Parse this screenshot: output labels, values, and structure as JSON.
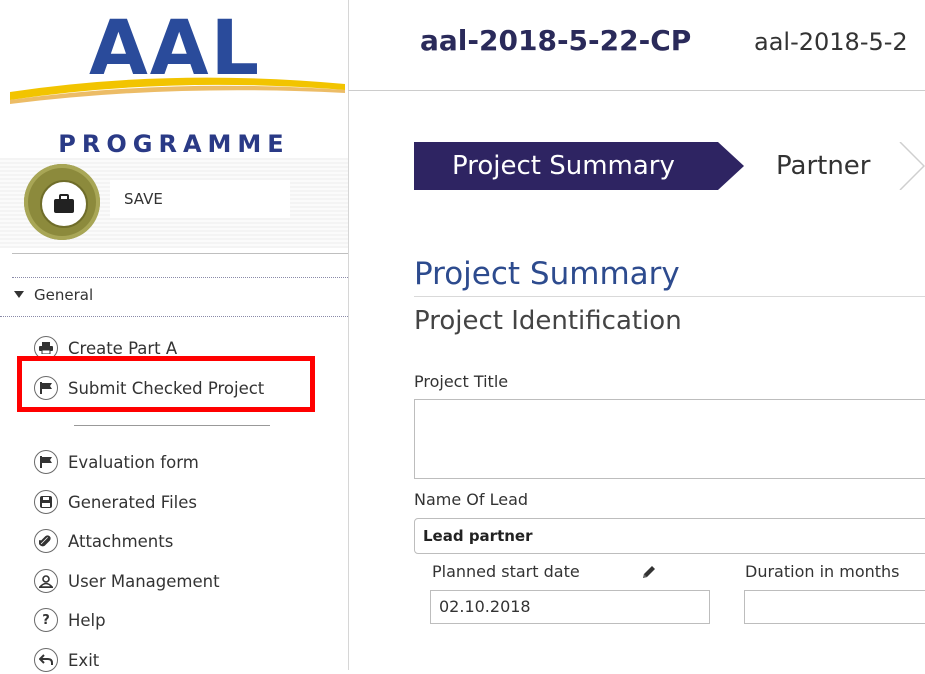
{
  "logo": {
    "brand": "AAL",
    "tagline": "PROGRAMME"
  },
  "toolbar": {
    "save_label": "SAVE"
  },
  "sidebar": {
    "group_label": "General",
    "items": [
      {
        "label": "Create Part A",
        "icon": "print-icon"
      },
      {
        "label": "Submit Checked Project",
        "icon": "flag-icon"
      },
      {
        "label": "Evaluation form",
        "icon": "flag-icon"
      },
      {
        "label": "Generated Files",
        "icon": "save-disk-icon"
      },
      {
        "label": "Attachments",
        "icon": "paperclip-icon"
      },
      {
        "label": "User Management",
        "icon": "user-icon"
      },
      {
        "label": "Help",
        "icon": "help-icon"
      },
      {
        "label": "Exit",
        "icon": "exit-arrow-icon"
      }
    ]
  },
  "header": {
    "project_id": "aal-2018-5-22-CP",
    "project_id_secondary": "aal-2018-5-2"
  },
  "steps": {
    "active": "Project Summary",
    "next": "Partner"
  },
  "main": {
    "section_title": "Project Summary",
    "subsection_title": "Project Identification",
    "fields": {
      "project_title_label": "Project Title",
      "project_title_value": "",
      "name_of_lead_label": "Name Of Lead",
      "name_of_lead_value": "Lead partner",
      "planned_start_label": "Planned start date",
      "planned_start_value": "02.10.2018",
      "duration_label": "Duration in months",
      "duration_value": ""
    }
  },
  "colors": {
    "brand_blue": "#2a4b9b",
    "step_active_bg": "#2e2462",
    "save_olive": "#8c8a3c",
    "highlight_red": "#ff0000",
    "section_title": "#2d4b8e"
  }
}
